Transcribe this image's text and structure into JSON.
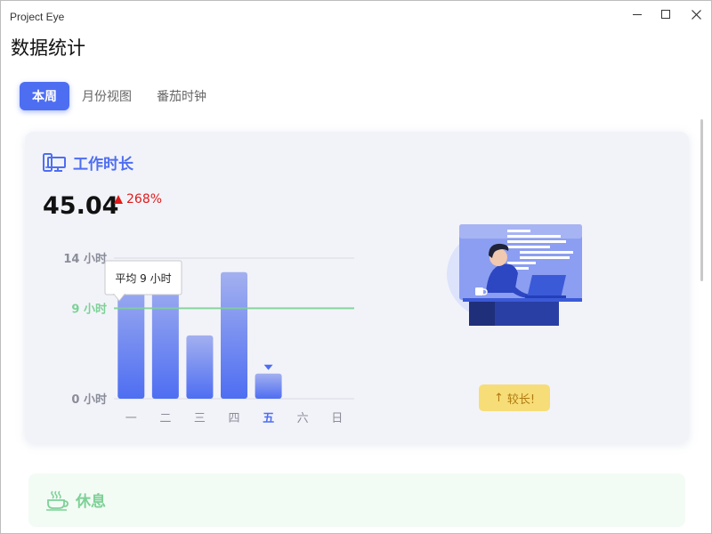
{
  "window": {
    "app_title": "Project Eye",
    "page_title": "数据统计"
  },
  "tabs": [
    {
      "label": "本周",
      "active": true
    },
    {
      "label": "月份视图",
      "active": false
    },
    {
      "label": "番茄时钟",
      "active": false
    }
  ],
  "work_card": {
    "icon": "computer-monitor-icon",
    "title": "工作时长",
    "total": "45.04",
    "change": "268%",
    "change_direction": "up",
    "badge": "较长!",
    "badge_icon": "arrow-up-icon"
  },
  "rest_card": {
    "icon": "coffee-cup-icon",
    "title": "休息"
  },
  "colors": {
    "accent": "#4e6ef2",
    "bar_gradient_top": "#a3b0ef",
    "bar_gradient_bottom": "#4e6ef2",
    "average_line": "#7dd196",
    "increase": "#e01b1b",
    "badge_bg": "#f7dd78",
    "rest_accent": "#7dd196"
  },
  "chart_data": {
    "type": "bar",
    "categories": [
      "一",
      "二",
      "三",
      "四",
      "五",
      "六",
      "日"
    ],
    "values": [
      12.2,
      12.2,
      6.3,
      12.6,
      2.5,
      0,
      0
    ],
    "ylim": [
      0,
      14
    ],
    "y_ticks": [
      {
        "value": 14,
        "label": "14 小时"
      },
      {
        "value": 9,
        "label": "9 小时"
      },
      {
        "value": 0,
        "label": "0 小时"
      }
    ],
    "average": 9,
    "average_tooltip": "平均 9 小时",
    "current_day_index": 4,
    "grid": true
  }
}
